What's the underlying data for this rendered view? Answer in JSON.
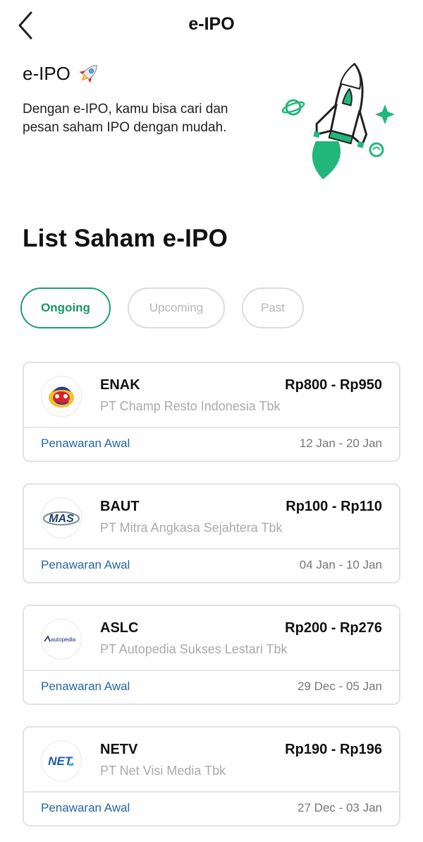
{
  "header": {
    "title": "e-IPO"
  },
  "intro": {
    "title": "e-IPO",
    "description": "Dengan e-IPO, kamu bisa cari dan pesan saham IPO dengan mudah."
  },
  "section_title": "List Saham e-IPO",
  "tabs": [
    {
      "label": "Ongoing",
      "active": true
    },
    {
      "label": "Upcoming",
      "active": false
    },
    {
      "label": "Past",
      "active": false
    }
  ],
  "ipo_list": [
    {
      "ticker": "ENAK",
      "company": "PT Champ Resto Indonesia Tbk",
      "price_range": "Rp800 - Rp950",
      "stage": "Penawaran Awal",
      "dates": "12 Jan - 20 Jan",
      "logo_icon": "champ-resto-logo"
    },
    {
      "ticker": "BAUT",
      "company": "PT Mitra Angkasa Sejahtera Tbk",
      "price_range": "Rp100 - Rp110",
      "stage": "Penawaran Awal",
      "dates": "04 Jan - 10 Jan",
      "logo_icon": "mas-logo",
      "logo_text": "MAS"
    },
    {
      "ticker": "ASLC",
      "company": "PT Autopedia Sukses Lestari Tbk",
      "price_range": "Rp200 - Rp276",
      "stage": "Penawaran Awal",
      "dates": "29 Dec - 05 Jan",
      "logo_icon": "autopedia-logo",
      "logo_text": "autopedia"
    },
    {
      "ticker": "NETV",
      "company": "PT Net Visi Media Tbk",
      "price_range": "Rp190 - Rp196",
      "stage": "Penawaran Awal",
      "dates": "27 Dec - 03 Jan",
      "logo_icon": "net-logo",
      "logo_text": "NET."
    }
  ],
  "colors": {
    "accent_green": "#1aa06a",
    "link_blue": "#2466a6",
    "muted_text": "#aaaaaa"
  }
}
